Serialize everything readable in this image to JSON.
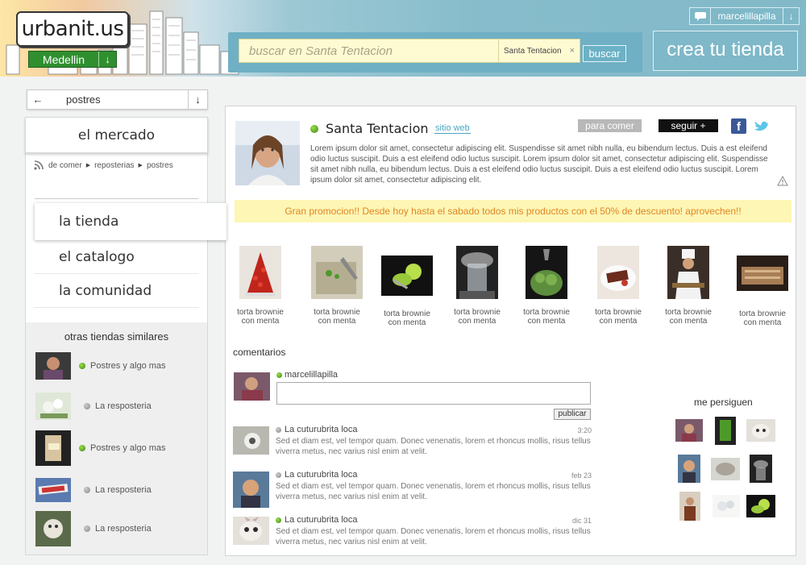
{
  "header": {
    "logo": "urbanit.us",
    "city": "Medellin",
    "search_placeholder": "buscar en Santa Tentacion",
    "search_chip": "Santa Tentacion",
    "search_chip_close": "×",
    "search_button": "buscar",
    "user_name": "marcelillapilla",
    "create_button": "crea tu tienda"
  },
  "sidebar": {
    "category": "postres",
    "mercado": "el mercado",
    "breadcrumb": [
      "de comer",
      "reposterias",
      "postres"
    ],
    "nav": [
      "la tienda",
      "el catalogo",
      "la comunidad"
    ],
    "similar_title": "otras tiendas similares",
    "similar": [
      {
        "name": "Postres y algo mas",
        "status": "online"
      },
      {
        "name": "La resposteria",
        "status": "offline"
      },
      {
        "name": "Postres y algo mas",
        "status": "online"
      },
      {
        "name": "La resposteria",
        "status": "offline"
      },
      {
        "name": "La resposteria",
        "status": "offline"
      }
    ]
  },
  "store": {
    "name": "Santa Tentacion",
    "website_link": "sitio web",
    "tag": "para comer",
    "follow_button": "seguir +",
    "description": "Lorem ipsum dolor sit amet, consectetur adipiscing elit. Suspendisse sit amet nibh nulla, eu bibendum lectus. Duis a est eleifend odio luctus suscipit. Duis a est eleifend odio luctus suscipit. Lorem ipsum dolor sit amet, consectetur adipiscing elit. Suspendisse sit amet nibh nulla, eu bibendum lectus. Duis a est eleifend odio luctus suscipit. Duis a est eleifend odio luctus suscipit. Lorem ipsum dolor sit amet, consectetur adipiscing elit.",
    "promo": "Gran promocion!! Desde hoy hasta el sabado todos mis productos con el 50% de descuento! aprovechen!!"
  },
  "products": [
    {
      "line1": "torta brownie",
      "line2": "con menta"
    },
    {
      "line1": "torta brownie",
      "line2": "con menta"
    },
    {
      "line1": "torta brownie",
      "line2": "con menta"
    },
    {
      "line1": "torta brownie",
      "line2": "con menta"
    },
    {
      "line1": "torta brownie",
      "line2": "con menta"
    },
    {
      "line1": "torta brownie",
      "line2": "con menta"
    },
    {
      "line1": "torta brownie",
      "line2": "con menta"
    },
    {
      "line1": "torta brownie",
      "line2": "con menta"
    }
  ],
  "comments_section": {
    "title": "comentarios",
    "current_user": "marcelillapilla",
    "publish_button": "publicar",
    "items": [
      {
        "author": "La cuturubrita loca",
        "time": "3:20",
        "status": "offline",
        "text": "Sed et diam est, vel tempor quam. Donec venenatis, lorem et rhoncus mollis, risus tellus viverra metus, nec varius nisl enim at velit."
      },
      {
        "author": "La cuturubrita loca",
        "time": "feb 23",
        "status": "offline",
        "text": "Sed et diam est, vel tempor quam. Donec venenatis, lorem et rhoncus mollis, risus tellus viverra metus, nec varius nisl enim at velit."
      },
      {
        "author": "La cuturubrita loca",
        "time": "dic 31",
        "status": "online",
        "text": "Sed et diam est, vel tempor quam. Donec venenatis, lorem et rhoncus mollis, risus tellus viverra metus, nec varius nisl enim at velit."
      }
    ]
  },
  "followers": {
    "title": "me persiguen"
  },
  "colors": {
    "accent_blue": "#7fb8c8",
    "brand_green": "#2f8f2f",
    "promo_text": "#e18624",
    "promo_bg": "#fdf6b4"
  }
}
